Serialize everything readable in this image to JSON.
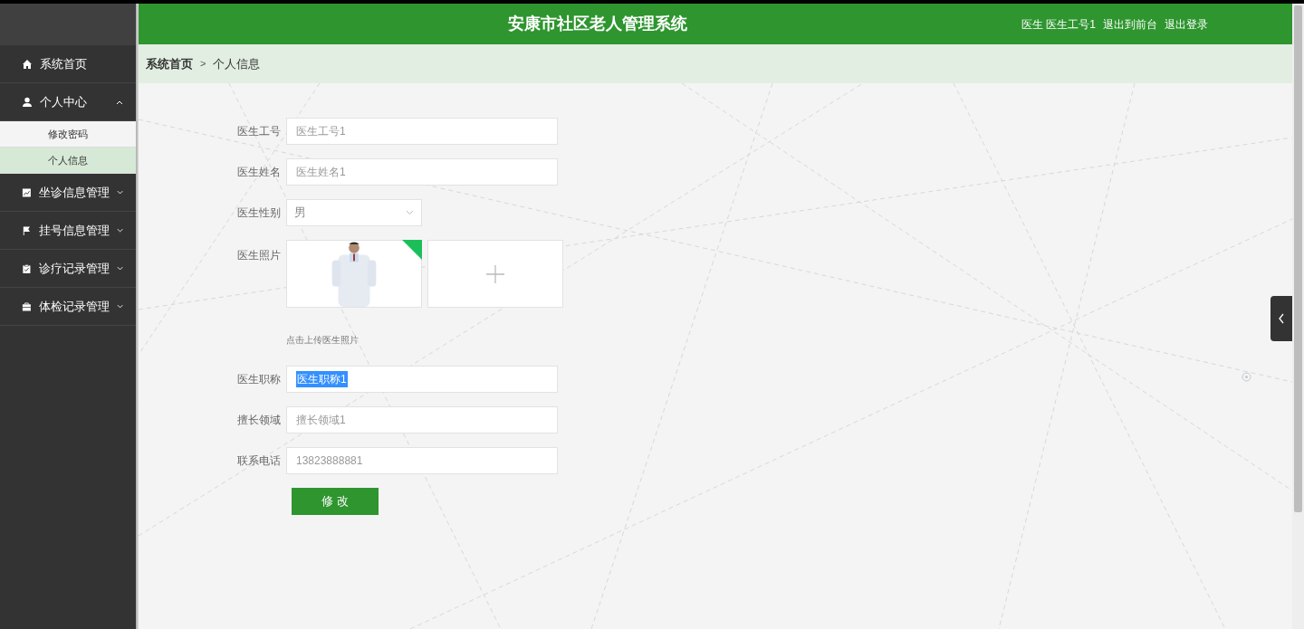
{
  "header": {
    "title": "安康市社区老人管理系统",
    "user_role": "医生",
    "user_name": "医生工号1",
    "links": [
      "退出到前台",
      "退出登录"
    ]
  },
  "sidebar": {
    "items": [
      {
        "label": "系统首页",
        "selected": false
      },
      {
        "label": "个人中心",
        "expanded": true,
        "selected": false,
        "children": [
          {
            "label": "修改密码",
            "selected": false
          },
          {
            "label": "个人信息",
            "selected": true
          }
        ]
      },
      {
        "label": "坐诊信息管理",
        "expanded": false,
        "selected": false
      },
      {
        "label": "挂号信息管理",
        "expanded": false,
        "selected": false
      },
      {
        "label": "诊疗记录管理",
        "expanded": false,
        "selected": false
      },
      {
        "label": "体检记录管理",
        "expanded": false,
        "selected": false
      }
    ]
  },
  "breadcrumb": [
    "系统首页",
    "个人信息"
  ],
  "breadcrumb_separator": ">",
  "form": {
    "fields": [
      {
        "kind": "input",
        "label": "医生工号",
        "value": "医生工号1",
        "highlighted": false
      },
      {
        "kind": "input",
        "label": "医生姓名",
        "value": "医生姓名1",
        "highlighted": false
      },
      {
        "kind": "select",
        "label": "医生性别",
        "value": "男"
      },
      {
        "label": "医生照片",
        "hint": "点击上传医生照片"
      },
      {
        "kind": "input",
        "label": "医生职称",
        "value": "医生职称1",
        "highlighted": true
      },
      {
        "kind": "input",
        "label": "擅长领域",
        "value": "擅长领域1",
        "highlighted": false
      },
      {
        "kind": "input",
        "label": "联系电话",
        "value": "13823888881",
        "highlighted": false
      }
    ],
    "submit": "修 改"
  }
}
